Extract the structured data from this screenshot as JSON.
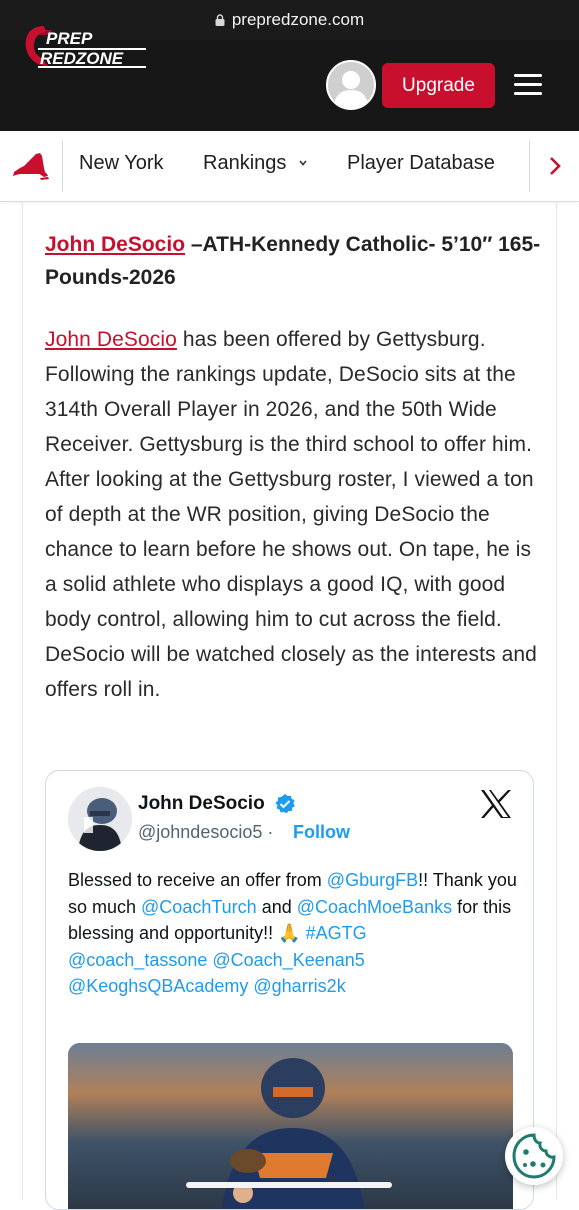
{
  "browser": {
    "url": "prepredzone.com"
  },
  "header": {
    "logo_line1": "PREP",
    "logo_line2": "REDZONE",
    "upgrade_label": "Upgrade",
    "brand_red": "#c8102e"
  },
  "subnav": {
    "state": "New York",
    "items": [
      "New York",
      "Rankings",
      "Player Database"
    ]
  },
  "article": {
    "headline_link": "John DeSocio",
    "headline_rest": " –ATH-Kennedy Catholic- 5’10″ 165-Pounds-2026",
    "body_link": "John DeSocio",
    "body_rest": "  has been offered by Gettysburg. Following the rankings update, DeSocio sits at the 314th Overall Player in 2026, and the 50th Wide Receiver. Gettysburg is the third school to offer him. After looking at the Gettysburg roster, I viewed a ton of depth at the WR position, giving DeSocio the chance to learn before he shows out. On tape, he is a solid athlete who displays a good IQ, with good body control, allowing him to cut across the field. DeSocio will be watched closely as the interests and offers roll in."
  },
  "tweet": {
    "name": "John DeSocio",
    "handle": "@johndesocio5",
    "separator": " · ",
    "follow_label": "Follow",
    "text_1": "Blessed to receive an offer from ",
    "mention_1": "@GburgFB",
    "text_2": "!! Thank you so much ",
    "mention_2": "@CoachTurch",
    "text_3": " and ",
    "mention_3": "@CoachMoeBanks",
    "text_4": " for this blessing and opportunity!! 🙏 ",
    "hashtag": "#AGTG",
    "mention_4": "@coach_tassone",
    "mention_5": "@Coach_Keenan5",
    "mention_6": "@KeoghsQBAcademy",
    "mention_7": "@gharris2k",
    "link_color": "#1d9bf0"
  },
  "icons": [
    "lock-icon",
    "avatar",
    "menu-icon",
    "new-york-map-icon",
    "chevron-down-icon",
    "chevron-right-icon",
    "verified-badge-icon",
    "x-logo-icon",
    "cookie-icon"
  ]
}
